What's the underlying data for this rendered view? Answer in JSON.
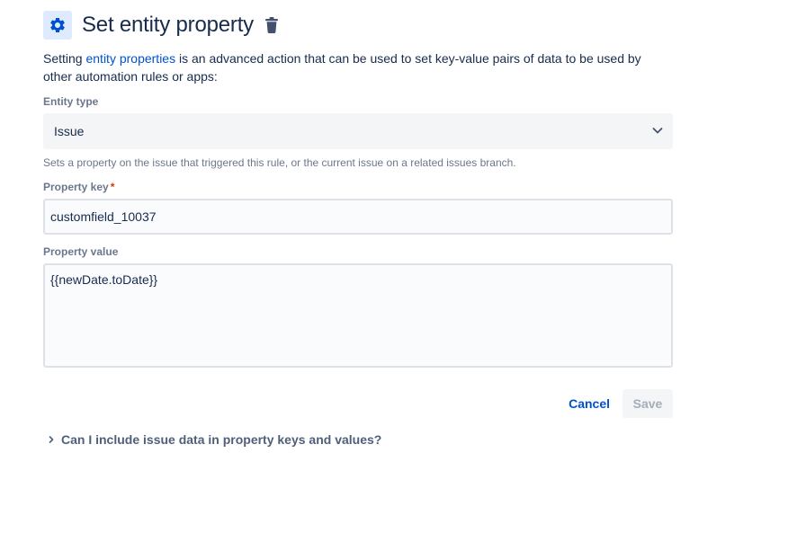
{
  "header": {
    "title": "Set entity property",
    "icon": "gear-icon",
    "delete_icon": "trash-icon"
  },
  "description": {
    "prefix": "Setting ",
    "link_text": "entity properties",
    "suffix": " is an advanced action that can be used to set key-value pairs of data to be used by other automation rules or apps:"
  },
  "entity_type": {
    "label": "Entity type",
    "selected": "Issue",
    "helper": "Sets a property on the issue that triggered this rule, or the current issue on a related issues branch."
  },
  "property_key": {
    "label": "Property key",
    "required_mark": "*",
    "value": "customfield_10037"
  },
  "property_value": {
    "label": "Property value",
    "value": "{{newDate.toDate}}"
  },
  "actions": {
    "cancel_label": "Cancel",
    "save_label": "Save"
  },
  "faq": {
    "question": "Can I include issue data in property keys and values?"
  },
  "colors": {
    "accent": "#0052cc",
    "icon_bg": "#deebff",
    "required": "#de350b",
    "disabled_text": "#a5adba"
  }
}
